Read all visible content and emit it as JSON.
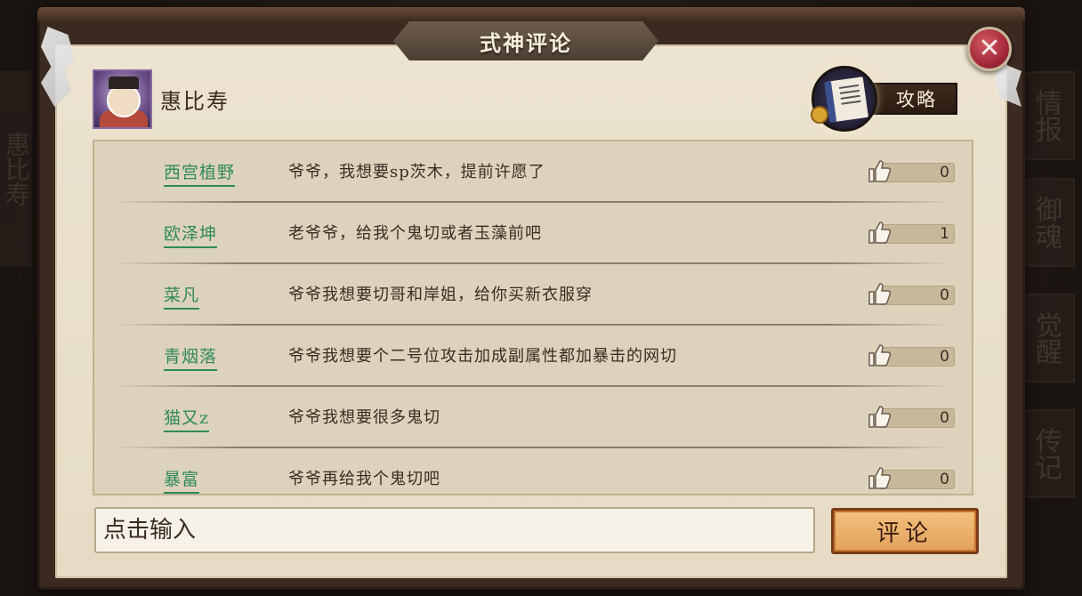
{
  "dialog": {
    "title": "式神评论",
    "close_icon": "close-icon"
  },
  "background": {
    "left_text": "惠比寿",
    "side_tabs": [
      "情报",
      "御魂",
      "觉醒",
      "传记"
    ]
  },
  "shikigami": {
    "name": "惠比寿",
    "guide_label": "攻略"
  },
  "comments": [
    {
      "user": "西宫植野",
      "text": "爷爷，我想要sp茨木，提前许愿了",
      "likes": "0"
    },
    {
      "user": "欧泽坤",
      "text": "老爷爷，给我个鬼切或者玉藻前吧",
      "likes": "1"
    },
    {
      "user": "菜凡",
      "text": "爷爷我想要切哥和岸姐，给你买新衣服穿",
      "likes": "0"
    },
    {
      "user": "青烟落",
      "text": "爷爷我想要个二号位攻击加成副属性都加暴击的网切",
      "likes": "0"
    },
    {
      "user": "猫又z",
      "text": "爷爷我想要很多鬼切",
      "likes": "0"
    },
    {
      "user": "暴富",
      "text": "爷爷再给我个鬼切吧",
      "likes": "0"
    }
  ],
  "composer": {
    "placeholder": "点击输入",
    "submit_label": "评论"
  }
}
